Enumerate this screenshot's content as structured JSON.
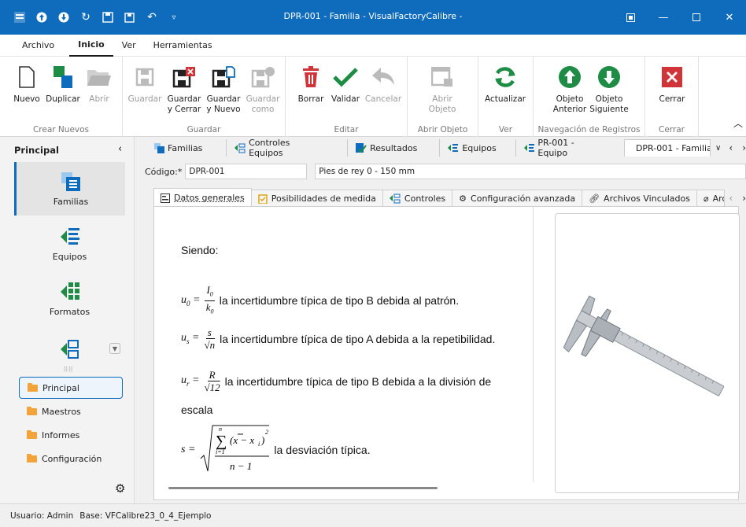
{
  "window": {
    "title": "DPR-001 - Familia - VisualFactoryCalibre -"
  },
  "menu": [
    "Archivo",
    "Inicio",
    "Ver",
    "Herramientas"
  ],
  "ribbon": {
    "groups": {
      "crear": "Crear Nuevos",
      "guardar": "Guardar",
      "editar": "Editar",
      "abrir": "Abrir Objeto",
      "ver": "Ver",
      "nav": "Navegación de Registros",
      "cerrar": "Cerrar"
    },
    "buttons": {
      "nuevo": "Nuevo",
      "duplicar": "Duplicar",
      "abrir": "Abrir",
      "guardar": "Guardar",
      "guardar_cerrar_1": "Guardar",
      "guardar_cerrar_2": "y Cerrar",
      "guardar_nuevo_1": "Guardar",
      "guardar_nuevo_2": "y Nuevo",
      "guardar_como_1": "Guardar",
      "guardar_como_2": "como",
      "borrar": "Borrar",
      "validar": "Validar",
      "cancelar": "Cancelar",
      "abrir_objeto_1": "Abrir",
      "abrir_objeto_2": "Objeto",
      "actualizar": "Actualizar",
      "obj_ant_1": "Objeto",
      "obj_ant_2": "Anterior",
      "obj_sig_1": "Objeto",
      "obj_sig_2": "Siguiente",
      "cerrar": "Cerrar"
    }
  },
  "sidebar": {
    "header": "Principal",
    "big_items": [
      "Familias",
      "Equipos",
      "Formatos"
    ],
    "small_items": [
      "Principal",
      "Maestros",
      "Informes",
      "Configuración"
    ]
  },
  "doc_tabs": [
    "Familias",
    "Controles Equipos",
    "Resultados",
    "Equipos",
    "PR-001 - Equipo",
    "DPR-001 - Familia"
  ],
  "form": {
    "codigo_label": "Código:*",
    "codigo_value": "DPR-001",
    "descripcion_value": "Pies de rey 0 - 150 mm"
  },
  "sub_tabs": [
    "Datos generales",
    "Posibilidades de medida",
    "Controles",
    "Configuración avanzada",
    "Archivos Vinculados",
    "Archivos A"
  ],
  "document": {
    "siendo": "Siendo:",
    "u0_text": "la incertidumbre típica de tipo B debida al patrón.",
    "us_text": "la incertidumbre típica de tipo A debida a la repetibilidad.",
    "ur_text": "la incertidumbre típica de tipo B debida a la división de",
    "ur_text2": "escala",
    "s_text": "la desviación típica."
  },
  "status": {
    "usuario": "Usuario: Admin",
    "base": "Base: VFCalibre23_0_4_Ejemplo"
  },
  "colors": {
    "accent": "#0f6cbd",
    "green": "#1e8c45",
    "red": "#d13438"
  }
}
